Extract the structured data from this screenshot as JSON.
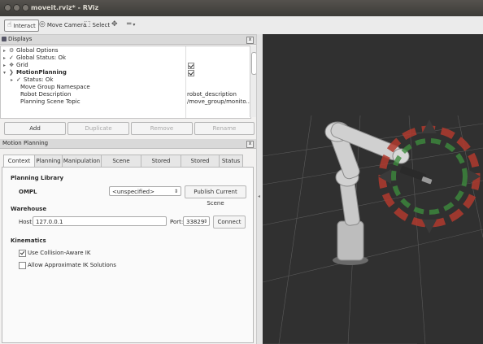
{
  "window": {
    "title": "moveit.rviz* - RViz"
  },
  "toolbar": {
    "interact": "Interact",
    "move_camera": "Move Camera",
    "select": "Select"
  },
  "displays": {
    "header": "Displays",
    "items": [
      {
        "label": "Global Options",
        "value": ""
      },
      {
        "label": "Global Status: Ok",
        "value": ""
      },
      {
        "label": "Grid",
        "value": ""
      },
      {
        "label": "MotionPlanning",
        "value": ""
      },
      {
        "label": "Status: Ok",
        "value": ""
      },
      {
        "label": "Move Group Namespace",
        "value": ""
      },
      {
        "label": "Robot Description",
        "value": "robot_description"
      },
      {
        "label": "Planning Scene Topic",
        "value": "/move_group/monito..."
      }
    ],
    "buttons": {
      "add": "Add",
      "duplicate": "Duplicate",
      "remove": "Remove",
      "rename": "Rename"
    }
  },
  "motion_planning": {
    "header": "Motion Planning",
    "tabs": [
      "Context",
      "Planning",
      "Manipulation",
      "Scene Objects",
      "Stored Scenes",
      "Stored States",
      "Status"
    ],
    "planning_library": {
      "title": "Planning Library",
      "name": "OMPL",
      "selected": "<unspecified>",
      "publish_button": "Publish Current Scene"
    },
    "warehouse": {
      "title": "Warehouse",
      "host_label": "Host:",
      "host_value": "127.0.0.1",
      "port_label": "Port:",
      "port_value": "33829",
      "connect_button": "Connect"
    },
    "kinematics": {
      "title": "Kinematics",
      "collision_aware": "Use Collision-Aware IK",
      "collision_aware_checked": true,
      "approx_ik": "Allow Approximate IK Solutions",
      "approx_ik_checked": false
    }
  },
  "colors": {
    "viewport_bg": "#303030",
    "robot": "#c8c8c8",
    "marker_red": "#b03a2e",
    "marker_green": "#3d8b3d",
    "grid": "#5a5a5a"
  }
}
